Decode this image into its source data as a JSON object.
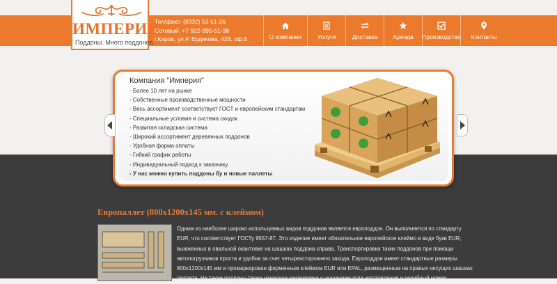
{
  "header": {
    "logo_text": "ИМПЕРИЯ",
    "tagline": "Поддоны. Много поддонов.",
    "phone": "Тел/факс: (8332) 53-51-26",
    "mobile": "Сотовый: +7 922-995-51-38",
    "address": "г.Киров, ул.Р. Ердякова, 42б, оф.5"
  },
  "nav": {
    "items": [
      {
        "label": "О компании",
        "icon": "home-icon"
      },
      {
        "label": "Услуги",
        "icon": "list-icon"
      },
      {
        "label": "Доставка",
        "icon": "transfer-icon"
      },
      {
        "label": "Аренда",
        "icon": "star-icon"
      },
      {
        "label": "Производство",
        "icon": "check-icon"
      },
      {
        "label": "Контакты",
        "icon": "map-pin-icon"
      }
    ]
  },
  "slider": {
    "title": "Компания \"Империя\"",
    "features": [
      "- Более 10 лет на рынке",
      "- Собственные производственные мощности",
      "- Весь ассортимент соответствует ГОСТ и европейским стандартам",
      "- Специальные условия и система скидок",
      "- Развитая складская система",
      "- Широкий ассортимент деревянных поддонов",
      "- Удобная форма оплаты",
      "- Гибкий график работы",
      "- Индивидуальный подход к заказчику",
      "- У нас можно купить поддоны бу и новые паллеты"
    ]
  },
  "article": {
    "title": "Европаллет (800x1200x145 мм. с клеймом)",
    "lines": [
      "Одним из наиболее широко используемых видов поддонов является европоддон. Он выполняется по стандарту",
      "EUR, что соответствует ГОСТу 9557-87. Это изделие имеет обязательное европейское клеймо в виде букв EUR,",
      "выжженных в овальной окантовке на шашках поддона справа. Транспортировка таких поддонов при помощи",
      "автопогрузчиков проста и удобна за счет четырехстороннего захода. Европоддон имеет стандартные размеры",
      "800x1200x145 мм и промаркирован фирменным клеймом EUR или EPAL, размещенным на правых несущих шашках",
      "паллета. На такие поддоны также нанесена маркировка с указанием года изготовления и серийный номер."
    ]
  },
  "colors": {
    "accent": "#ec7a2c",
    "dark": "#3c3c3c",
    "background": "#f2f1ef"
  }
}
